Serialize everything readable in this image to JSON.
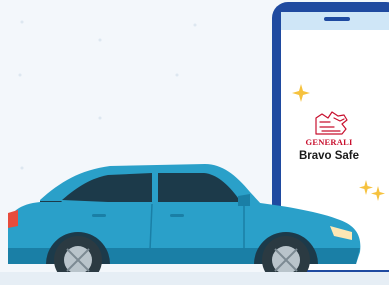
{
  "colors": {
    "background": "#f3f7fb",
    "phone_frame": "#1f4aa0",
    "phone_screen": "#ffffff",
    "phone_bezel_accent": "#cfe6f7",
    "car_body": "#2aa0c9",
    "car_dark": "#1a7fa6",
    "brand_red": "#c8102e",
    "sparkle": "#f6c23e"
  },
  "logo": {
    "icon": "generali-lion-icon",
    "wordmark": "GENERALI"
  },
  "app": {
    "name": "Bravo Safe"
  },
  "decor": {
    "sparkle_icon": "sparkle-icon",
    "car_icon": "hatchback-car-illustration"
  }
}
